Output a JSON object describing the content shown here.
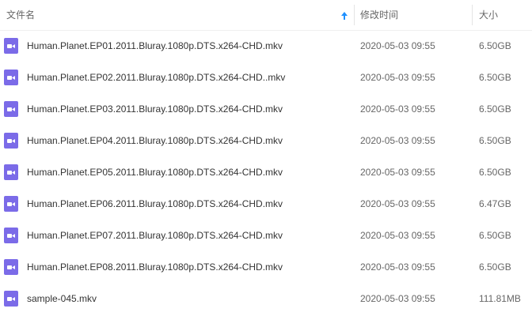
{
  "header": {
    "name_label": "文件名",
    "time_label": "修改时间",
    "size_label": "大小",
    "sort_icon": "sort-ascending-arrow-icon",
    "sort_icon_color": "#1e90ff"
  },
  "file_icon": {
    "name": "video-file-icon",
    "color": "#7b6be8"
  },
  "files": [
    {
      "name": "Human.Planet.EP01.2011.Bluray.1080p.DTS.x264-CHD.mkv",
      "time": "2020-05-03 09:55",
      "size": "6.50GB"
    },
    {
      "name": "Human.Planet.EP02.2011.Bluray.1080p.DTS.x264-CHD..mkv",
      "time": "2020-05-03 09:55",
      "size": "6.50GB"
    },
    {
      "name": "Human.Planet.EP03.2011.Bluray.1080p.DTS.x264-CHD.mkv",
      "time": "2020-05-03 09:55",
      "size": "6.50GB"
    },
    {
      "name": "Human.Planet.EP04.2011.Bluray.1080p.DTS.x264-CHD.mkv",
      "time": "2020-05-03 09:55",
      "size": "6.50GB"
    },
    {
      "name": "Human.Planet.EP05.2011.Bluray.1080p.DTS.x264-CHD.mkv",
      "time": "2020-05-03 09:55",
      "size": "6.50GB"
    },
    {
      "name": "Human.Planet.EP06.2011.Bluray.1080p.DTS.x264-CHD.mkv",
      "time": "2020-05-03 09:55",
      "size": "6.47GB"
    },
    {
      "name": "Human.Planet.EP07.2011.Bluray.1080p.DTS.x264-CHD.mkv",
      "time": "2020-05-03 09:55",
      "size": "6.50GB"
    },
    {
      "name": "Human.Planet.EP08.2011.Bluray.1080p.DTS.x264-CHD.mkv",
      "time": "2020-05-03 09:55",
      "size": "6.50GB"
    },
    {
      "name": "sample-045.mkv",
      "time": "2020-05-03 09:55",
      "size": "111.81MB"
    }
  ]
}
